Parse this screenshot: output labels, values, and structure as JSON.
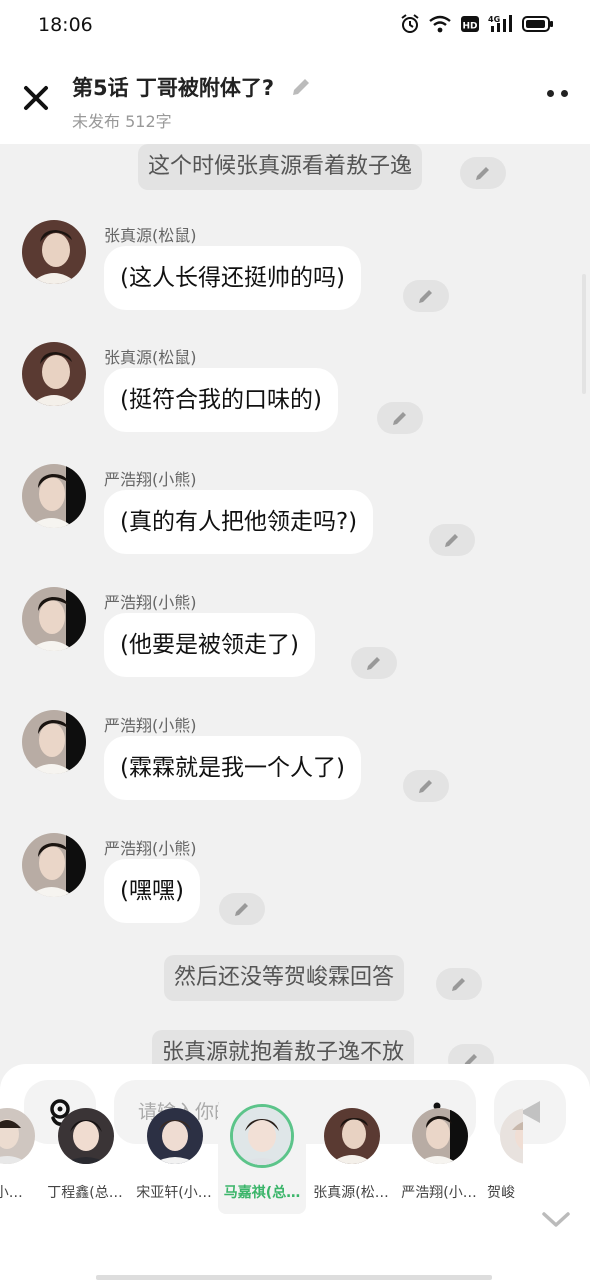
{
  "status_bar": {
    "time": "18:06",
    "network": "4G"
  },
  "header": {
    "title": "第5话   丁哥被附体了?",
    "subtitle": "未发布 512字"
  },
  "messages": [
    {
      "type": "narration",
      "text": "这个时候张真源看着敖子逸"
    },
    {
      "type": "character",
      "speaker": "张真源(松鼠)",
      "text": "(这人长得还挺帅的吗)"
    },
    {
      "type": "character",
      "speaker": "张真源(松鼠)",
      "text": "(挺符合我的口味的)"
    },
    {
      "type": "character",
      "speaker": "严浩翔(小熊)",
      "text": "(真的有人把他领走吗?)"
    },
    {
      "type": "character",
      "speaker": "严浩翔(小熊)",
      "text": "(他要是被领走了)"
    },
    {
      "type": "character",
      "speaker": "严浩翔(小熊)",
      "text": "(霖霖就是我一个人了)"
    },
    {
      "type": "character",
      "speaker": "严浩翔(小熊)",
      "text": "(嘿嘿)"
    },
    {
      "type": "narration",
      "text": "然后还没等贺峻霖回答"
    },
    {
      "type": "narration",
      "text": "张真源就抱着敖子逸不放"
    }
  ],
  "composer": {
    "placeholder": "请输入你的脑洞~"
  },
  "characters": [
    {
      "label": "(小…"
    },
    {
      "label": "丁程鑫(总…"
    },
    {
      "label": "宋亚轩(小…"
    },
    {
      "label": "马嘉祺(总…",
      "selected": true
    },
    {
      "label": "张真源(松…"
    },
    {
      "label": "严浩翔(小…"
    },
    {
      "label": "贺峻"
    }
  ],
  "colors": {
    "accent": "#3bb56a",
    "background": "#f1f1f1",
    "bubble": "#ffffff",
    "narration": "#e3e3e3"
  }
}
